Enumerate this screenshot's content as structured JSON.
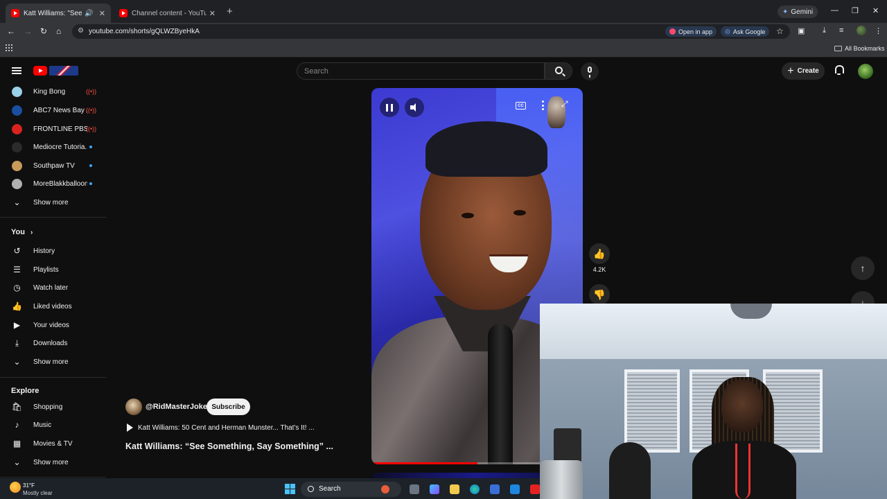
{
  "browser": {
    "tabs": [
      {
        "title": "Katt Williams: \"See Someth",
        "active": true,
        "audio_icon": "speaker-icon"
      },
      {
        "title": "Channel content - YouTube Stu",
        "active": false
      }
    ],
    "new_tab": "+",
    "gemini_label": "Gemini",
    "url": "youtube.com/shorts/gQLWZByeHkA",
    "open_in_app": "Open in app",
    "ask_google": "Ask Google",
    "all_bookmarks": "All Bookmarks"
  },
  "header": {
    "search_placeholder": "Search",
    "create_label": "Create"
  },
  "sidebar": {
    "subscriptions": [
      {
        "name": "King Bong",
        "status": "live",
        "color": "#9ad0e8"
      },
      {
        "name": "ABC7 News Bay ...",
        "status": "live",
        "color": "#1a4fa0"
      },
      {
        "name": "FRONTLINE PBS ...",
        "status": "live",
        "color": "#d8231f"
      },
      {
        "name": "Mediocre Tutoria...",
        "status": "new",
        "color": "#2b2b2b"
      },
      {
        "name": "Southpaw TV",
        "status": "new",
        "color": "#c89b5a"
      },
      {
        "name": "MoreBlakkballoon",
        "status": "new",
        "color": "#b0b0b0"
      }
    ],
    "show_more": "Show more",
    "you_heading": "You",
    "you_items": [
      {
        "label": "History",
        "icon": "history-icon"
      },
      {
        "label": "Playlists",
        "icon": "playlists-icon"
      },
      {
        "label": "Watch later",
        "icon": "clock-icon"
      },
      {
        "label": "Liked videos",
        "icon": "thumb-up-icon"
      },
      {
        "label": "Your videos",
        "icon": "video-icon"
      },
      {
        "label": "Downloads",
        "icon": "download-icon"
      }
    ],
    "explore_heading": "Explore",
    "explore_items": [
      {
        "label": "Shopping",
        "icon": "shopping-bag-icon"
      },
      {
        "label": "Music",
        "icon": "music-note-icon"
      },
      {
        "label": "Movies & TV",
        "icon": "film-icon"
      }
    ]
  },
  "short": {
    "like_count": "4.2K",
    "channel": "@RidMasterJoke",
    "subscribe_label": "Subscribe",
    "related_title": "Katt Williams: 50 Cent and Herman Munster... That's It! ...",
    "title": "Katt Williams: “See Something, Say Something” ...",
    "progress": 0.5,
    "cc_label": "CC"
  },
  "taskbar": {
    "temperature": "31°F",
    "condition": "Mostly clear",
    "search_label": "Search"
  },
  "colors": {
    "background": "#0f0f0f",
    "youtube_red": "#ff0000",
    "live_red": "#ff4e45",
    "new_dot": "#3ea6ff"
  }
}
